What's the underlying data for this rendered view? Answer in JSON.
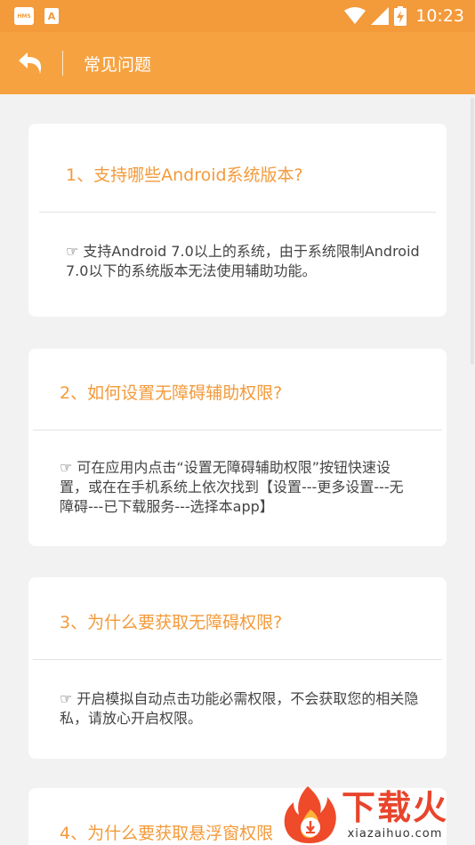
{
  "status": {
    "hms_icon_text": "HMS",
    "a_icon_text": "A",
    "time": "10:23"
  },
  "appbar": {
    "title": "常见问题"
  },
  "faq": [
    {
      "q": "1、支持哪些Android系统版本?",
      "a": "☞ 支持Android 7.0以上的系统，由于系统限制Android 7.0以下的系统版本无法使用辅助功能。"
    },
    {
      "q": "2、如何设置无障碍辅助权限?",
      "a": "☞ 可在应用内点击“设置无障碍辅助权限”按钮快速设置，或在在手机系统上依次找到【设置---更多设置---无障碍---已下载服务---选择本app】"
    },
    {
      "q": "3、为什么要获取无障碍权限?",
      "a": "☞ 开启模拟自动点击功能必需权限，不会获取您的相关隐私，请放心开启权限。"
    },
    {
      "q": "4、为什么要获取悬浮窗权限"
    }
  ],
  "watermark": {
    "cn": "下载火",
    "en": "xiazaihuo.com"
  },
  "colors": {
    "accent": "#f7a240",
    "question_text": "#f39a3a",
    "watermark_red": "#e8452c"
  }
}
